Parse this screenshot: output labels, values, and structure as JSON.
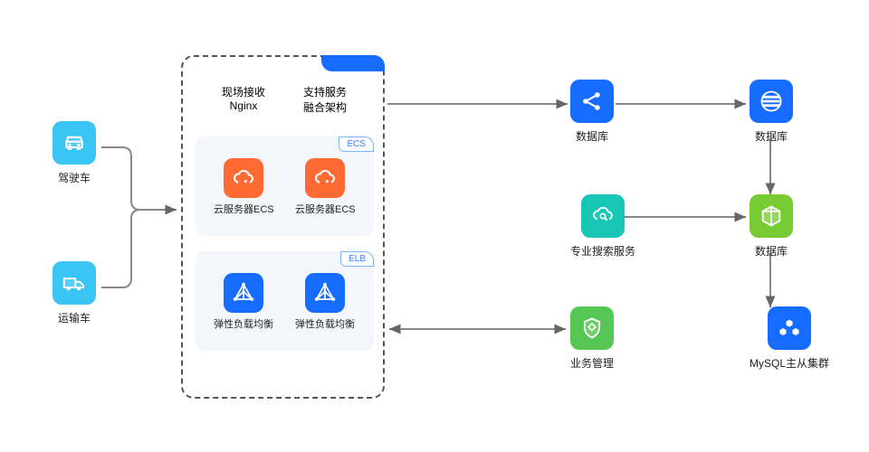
{
  "left": {
    "car": {
      "label": "驾驶车"
    },
    "truck": {
      "label": "运输车"
    }
  },
  "center": {
    "col1": {
      "line1": "现场接收",
      "line2": "Nginx"
    },
    "col2": {
      "line1": "支持服务",
      "line2": "融合架构"
    },
    "ecs": {
      "tag": "ECS",
      "item1": "云服务器ECS",
      "item2": "云服务器ECS"
    },
    "elb": {
      "tag": "ELB",
      "item1": "弹性负载均衡",
      "item2": "弹性负载均衡"
    }
  },
  "right": {
    "r1c1": "数据库",
    "r1c2": "数据库",
    "r2c1": "专业搜索服务",
    "r2c2": "数据库",
    "r3c1": "业务管理",
    "r3c2": "MySQL主从集群"
  }
}
